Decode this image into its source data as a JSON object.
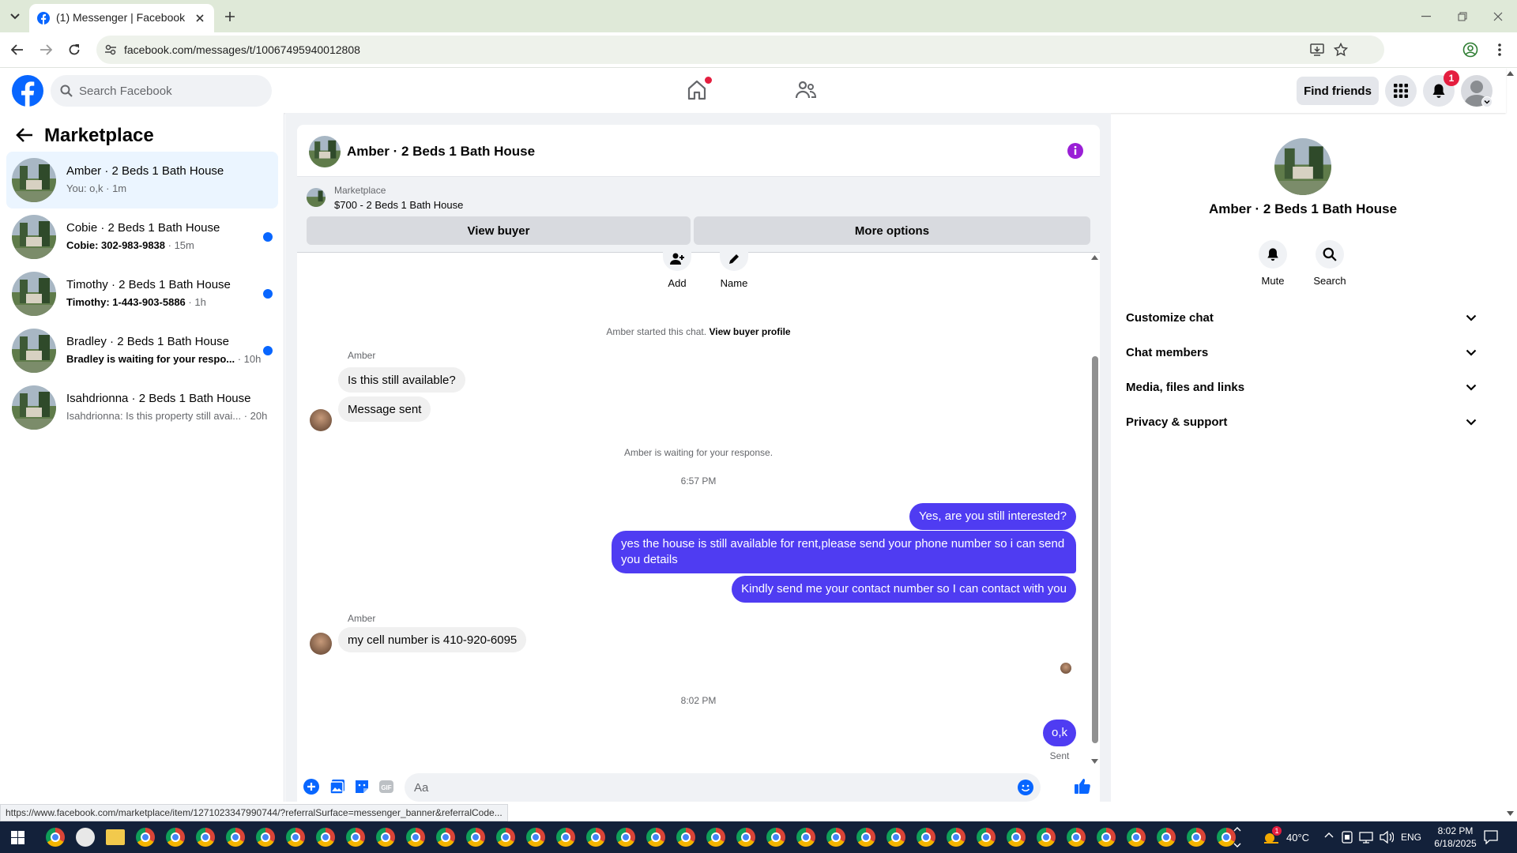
{
  "browser": {
    "tab_title": "(1) Messenger | Facebook",
    "url": "facebook.com/messages/t/10067495940012808",
    "status_url": "https://www.facebook.com/marketplace/item/1271023347990744/?referralSurface=messenger_banner&referralCode..."
  },
  "header": {
    "search_placeholder": "Search Facebook",
    "find_friends": "Find friends",
    "notif_count": "1"
  },
  "sidebar": {
    "title": "Marketplace",
    "conversations": [
      {
        "name": "Amber · 2 Beds 1 Bath House",
        "snippet": "You: o,k",
        "time": " · 1m",
        "unread": false
      },
      {
        "name": "Cobie · 2 Beds 1 Bath House",
        "snippet": "Cobie: 302-983-9838",
        "time": " · 15m",
        "unread": true
      },
      {
        "name": "Timothy · 2 Beds 1 Bath House",
        "snippet": "Timothy: 1-443-903-5886",
        "time": " · 1h",
        "unread": true
      },
      {
        "name": "Bradley · 2 Beds 1 Bath House",
        "snippet": "Bradley is waiting for your respo...",
        "time": " · 10h",
        "unread": true
      },
      {
        "name": "Isahdrionna · 2 Beds 1 Bath House",
        "snippet": "Isahdrionna: Is this property still avai...",
        "time": " · 20h",
        "unread": false
      }
    ]
  },
  "chat": {
    "title": "Amber · 2 Beds 1 Bath House",
    "listing_label": "Marketplace",
    "listing_price": "$700 - 2 Beds 1 Bath House",
    "view_buyer": "View buyer",
    "more_options": "More options",
    "add_label": "Add",
    "name_label": "Name",
    "started_text": "Amber started this chat.",
    "view_buyer_profile": "View buyer profile",
    "sender_name": "Amber",
    "msg_in_1": "Is this still available?",
    "msg_in_2": "Message sent",
    "waiting_text": "Amber is waiting for your response.",
    "time_1": "6:57 PM",
    "msg_out_1": "Yes, are you still interested?",
    "msg_out_2": "yes the house is still available for rent,please send your  phone number so i can send you details",
    "msg_out_3": "Kindly send me your contact number so I can contact with you",
    "msg_in_3": "my cell number is 410-920-6095",
    "time_2": "8:02 PM",
    "msg_out_4": "o,k",
    "sent_status": "Sent",
    "composer_placeholder": "Aa"
  },
  "info_panel": {
    "title": "Amber · 2 Beds 1 Bath House",
    "mute": "Mute",
    "search": "Search",
    "sections": [
      "Customize chat",
      "Chat members",
      "Media, files and links",
      "Privacy & support"
    ]
  },
  "taskbar": {
    "temperature": "40°C",
    "language": "ENG",
    "time": "8:02 PM",
    "date": "6/18/2025",
    "weather_badge": "1"
  },
  "colors": {
    "brand": "#0866ff",
    "outgoing_bubble": "#4f3cf2",
    "info_icon": "#9a1fd6",
    "notif_badge": "#e41e3f"
  }
}
